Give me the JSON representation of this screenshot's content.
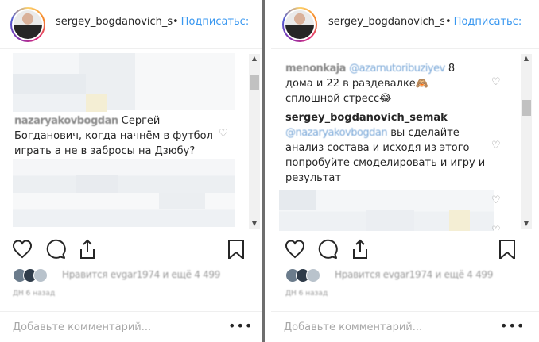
{
  "left_post": {
    "username": "sergey_bogdanovich_se",
    "follow": "Подписатьс:",
    "separator": "•",
    "comment": {
      "author": "nazaryakovbogdan",
      "text": "Сергей Богданович, когда начнём в футбол играть а не в забросы на Дзюбу?"
    },
    "likes_text": "Нравится evgar1974 и ещё 4 499",
    "time_ago": "ДН 6 назад",
    "add_comment_placeholder": "Добавьте комментарий...",
    "more": "•••"
  },
  "right_post": {
    "username": "sergey_bogdanovich_se",
    "follow": "Подписатьс:",
    "separator": "•",
    "comment1": {
      "author": "menonkaja",
      "mention": "@azarnutoribuziyev",
      "text": "8 дома и 22 в раздевалке🙈 сплошной стресс😂"
    },
    "comment2": {
      "author": "sergey_bogdanovich_semak",
      "mention": "@nazaryakovbogdan",
      "text": "вы сделайте анализ состава и исходя из этого попробуйте смоделировать и игру и результат"
    },
    "likes_text": "Нравится evgar1974 и ещё 4 499",
    "time_ago": "ДН 6 назад",
    "add_comment_placeholder": "Добавьте комментарий...",
    "more": "•••"
  },
  "icons": {
    "like": "heart-icon",
    "comment": "comment-icon",
    "share": "share-icon",
    "save": "bookmark-icon",
    "comment_like": "small-heart-icon"
  },
  "colors": {
    "follow_blue": "#3897f0",
    "text": "#262626",
    "muted": "#9a9a9a",
    "divider": "#6e6e6e"
  }
}
